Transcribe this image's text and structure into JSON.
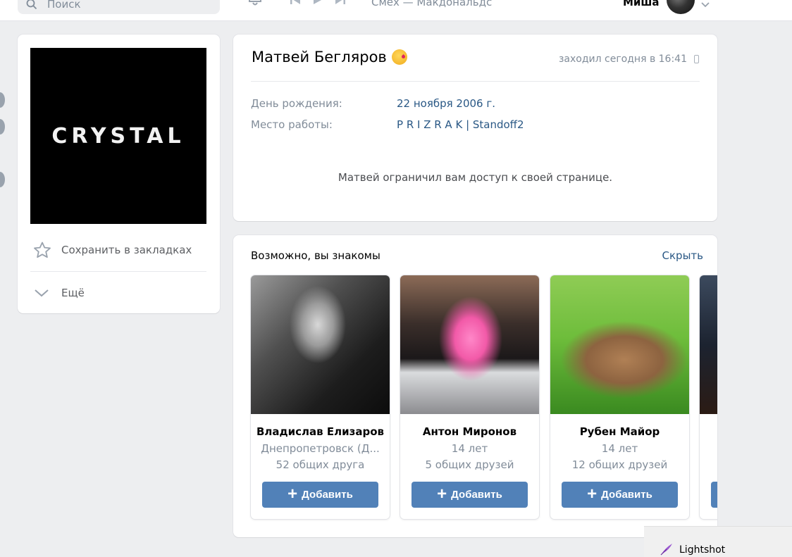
{
  "header": {
    "search_placeholder": "Поиск",
    "track_title": "Смех — Макдональдс",
    "user_name": "Миша"
  },
  "left_panel": {
    "cover_text": "CRYSTAL",
    "bookmark_label": "Сохранить в закладках",
    "more_label": "Ещё"
  },
  "profile": {
    "name": "Матвей Бегляров",
    "emoji": "kissing-face-icon",
    "last_seen": "заходил сегодня в 16:41",
    "birthday_label": "День рождения:",
    "birthday_value": "22 ноября 2006 г.",
    "work_label": "Место работы:",
    "work_value": "P R I Z R A K | Standoff2",
    "restricted_message": "Матвей ограничил вам доступ к своей странице."
  },
  "suggestions": {
    "title": "Возможно, вы знакомы",
    "hide_label": "Скрыть",
    "add_label": "Добавить",
    "people": [
      {
        "name": "Владислав Елизаров",
        "line1": "Днепропетровск (Д...",
        "line2": "52 общих друга"
      },
      {
        "name": "Антон Миронов",
        "line1": "14 лет",
        "line2": "5 общих друзей"
      },
      {
        "name": "Рубен Майор",
        "line1": "14 лет",
        "line2": "12 общих друзей"
      },
      {
        "name": "",
        "line1": "",
        "line2": ""
      }
    ]
  },
  "overlay": {
    "lightshot_label": "Lightshot"
  },
  "colors": {
    "accent": "#5181b8",
    "link": "#2a5885",
    "muted": "#818c99",
    "background": "#edeef0"
  }
}
